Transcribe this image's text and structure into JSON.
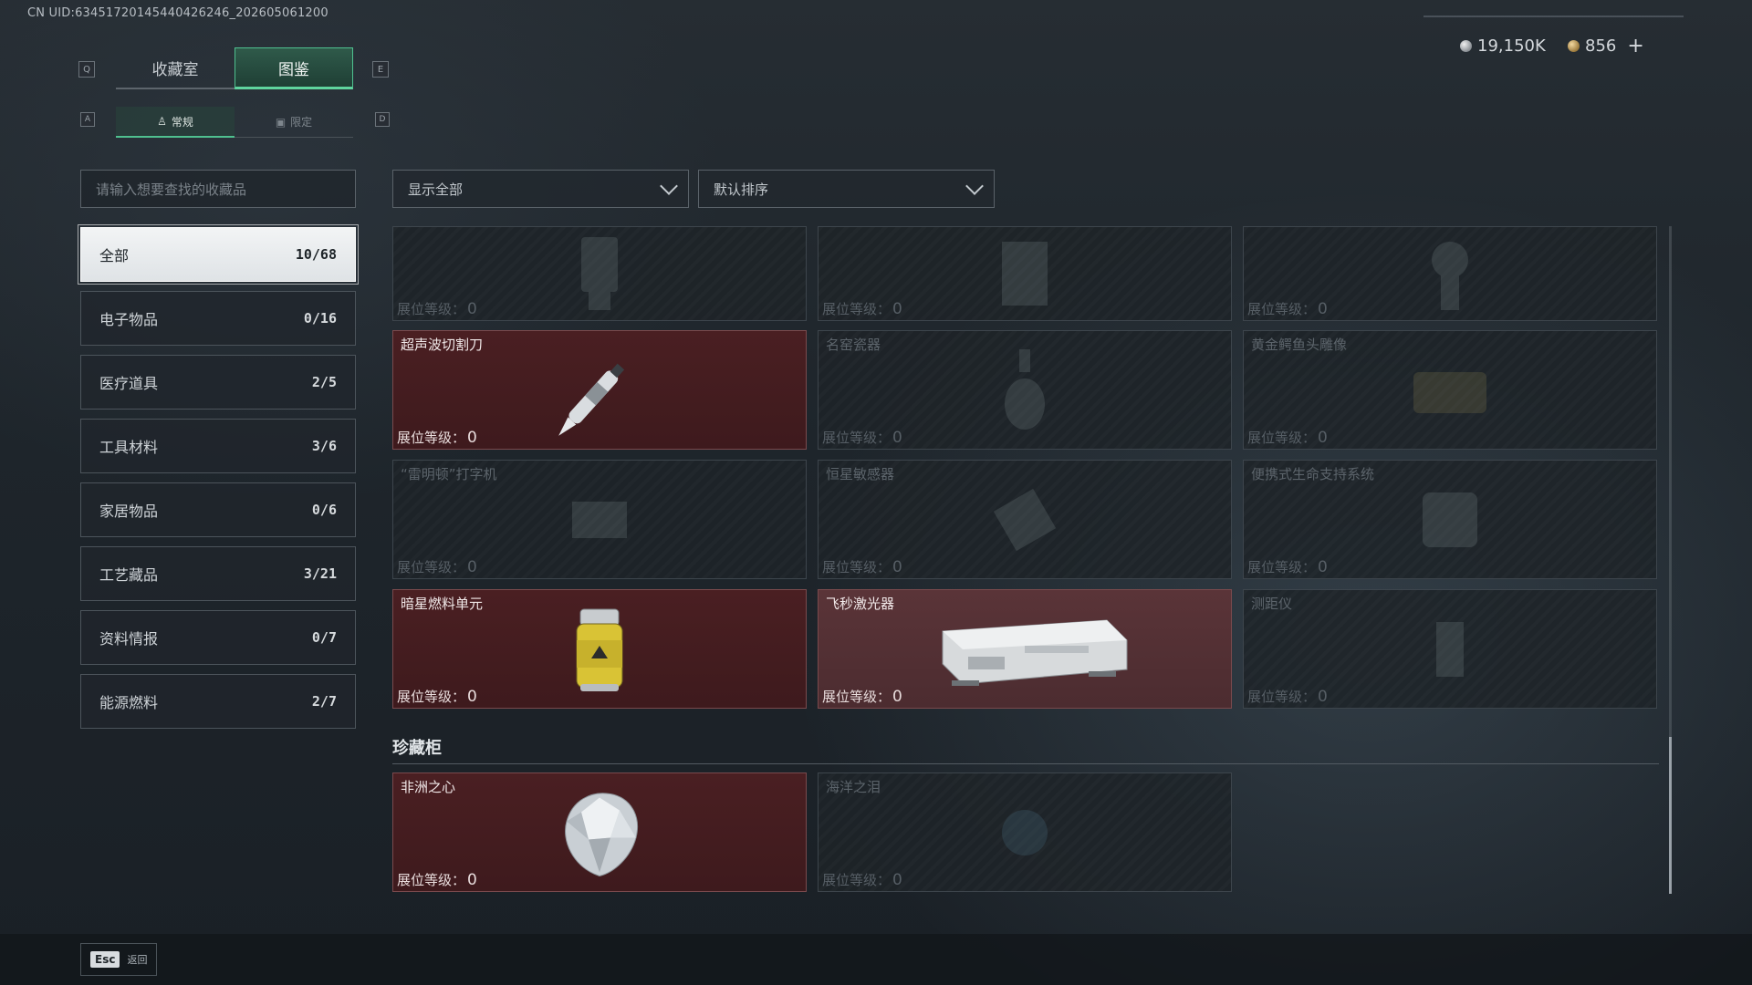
{
  "header": {
    "uid": "CN UID:63451720145440426246_202605061200",
    "currency": {
      "silver": "19,150K",
      "gold": "856",
      "add": "+"
    }
  },
  "tabs_primary": {
    "key_left": "Q",
    "key_right": "E",
    "items": [
      {
        "label": "收藏室"
      },
      {
        "label": "图鉴"
      }
    ]
  },
  "tabs_secondary": {
    "key_left": "A",
    "key_right": "D",
    "items": [
      {
        "label": "常规"
      },
      {
        "label": "限定"
      }
    ]
  },
  "search": {
    "placeholder": "请输入想要查找的收藏品"
  },
  "filters": {
    "show": "显示全部",
    "sort": "默认排序"
  },
  "categories": [
    {
      "label": "全部",
      "count": "10/68"
    },
    {
      "label": "电子物品",
      "count": "0/16"
    },
    {
      "label": "医疗道具",
      "count": "2/5"
    },
    {
      "label": "工具材料",
      "count": "3/6"
    },
    {
      "label": "家居物品",
      "count": "0/6"
    },
    {
      "label": "工艺藏品",
      "count": "3/21"
    },
    {
      "label": "资料情报",
      "count": "0/7"
    },
    {
      "label": "能源燃料",
      "count": "2/7"
    }
  ],
  "level_label": "展位等级：",
  "grid": [
    {
      "name": "",
      "level": "0",
      "owned": false
    },
    {
      "name": "",
      "level": "0",
      "owned": false
    },
    {
      "name": "",
      "level": "0",
      "owned": false
    },
    {
      "name": "超声波切割刀",
      "level": "0",
      "owned": true
    },
    {
      "name": "名窑瓷器",
      "level": "0",
      "owned": false
    },
    {
      "name": "黄金鳄鱼头雕像",
      "level": "0",
      "owned": false
    },
    {
      "name": "“雷明顿”打字机",
      "level": "0",
      "owned": false
    },
    {
      "name": "恒星敏感器",
      "level": "0",
      "owned": false
    },
    {
      "name": "便携式生命支持系统",
      "level": "0",
      "owned": false
    },
    {
      "name": "暗星燃料单元",
      "level": "0",
      "owned": true
    },
    {
      "name": "飞秒激光器",
      "level": "0",
      "owned": true
    },
    {
      "name": "测距仪",
      "level": "0",
      "owned": false
    }
  ],
  "cabinet": {
    "title": "珍藏柜",
    "items": [
      {
        "name": "非洲之心",
        "level": "0",
        "owned": true
      },
      {
        "name": "海洋之泪",
        "level": "0",
        "owned": false
      }
    ]
  },
  "footer": {
    "key": "Esc",
    "label": "返回"
  }
}
